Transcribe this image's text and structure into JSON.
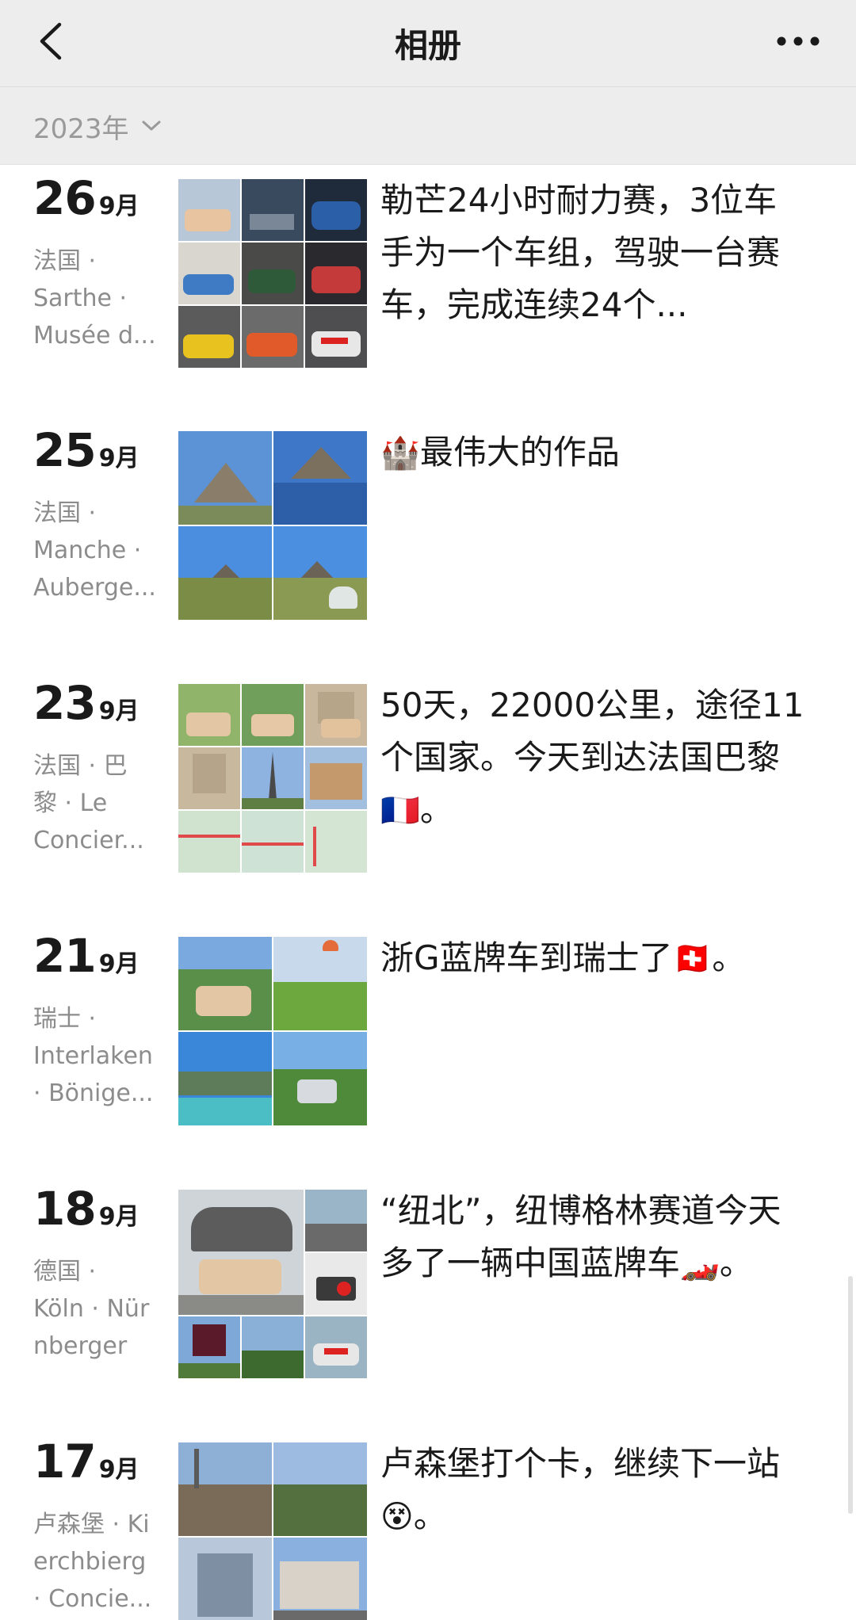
{
  "header": {
    "title": "相册",
    "back_icon": "chevron-left-icon",
    "more_icon": "more-horizontal-icon"
  },
  "year_filter": {
    "label": "2023年",
    "icon": "chevron-down-icon"
  },
  "entries": [
    {
      "day": "26",
      "month": "9月",
      "location": [
        "法国 ·",
        "Sarthe ·",
        "Musée d..."
      ],
      "caption": "勒芒24小时耐力赛，3位车手为一个车组，驾驶一台赛车，完成连续24个..."
    },
    {
      "day": "25",
      "month": "9月",
      "location": [
        "法国 ·",
        "Manche ·",
        "Auberge..."
      ],
      "caption": "最伟大的作品",
      "caption_emoji": "🏰"
    },
    {
      "day": "23",
      "month": "9月",
      "location": [
        "法国 · 巴",
        "黎 · Le",
        "Concier..."
      ],
      "caption": "50天，22000公里，途径11个国家。今天到达法国巴黎",
      "caption_emoji_end": "🇫🇷",
      "caption_tail": "。"
    },
    {
      "day": "21",
      "month": "9月",
      "location": [
        "瑞士 ·",
        "Interlaken",
        "· Bönige..."
      ],
      "caption": "浙G蓝牌车到瑞士了",
      "caption_emoji_end": "🇨🇭",
      "caption_tail": "。"
    },
    {
      "day": "18",
      "month": "9月",
      "location": [
        "德国 ·",
        "Köln · Nür",
        "nberger"
      ],
      "caption": "“纽北”，纽博格林赛道今天多了一辆中国蓝牌车",
      "caption_emoji_end": "🏎️",
      "caption_tail": "。"
    },
    {
      "day": "17",
      "month": "9月",
      "location": [
        "卢森堡 · Ki",
        "erchbierg",
        "· Concie..."
      ],
      "caption": "卢森堡打个卡，继续下一站",
      "caption_emoji_end": "😵",
      "caption_tail": "。"
    }
  ]
}
